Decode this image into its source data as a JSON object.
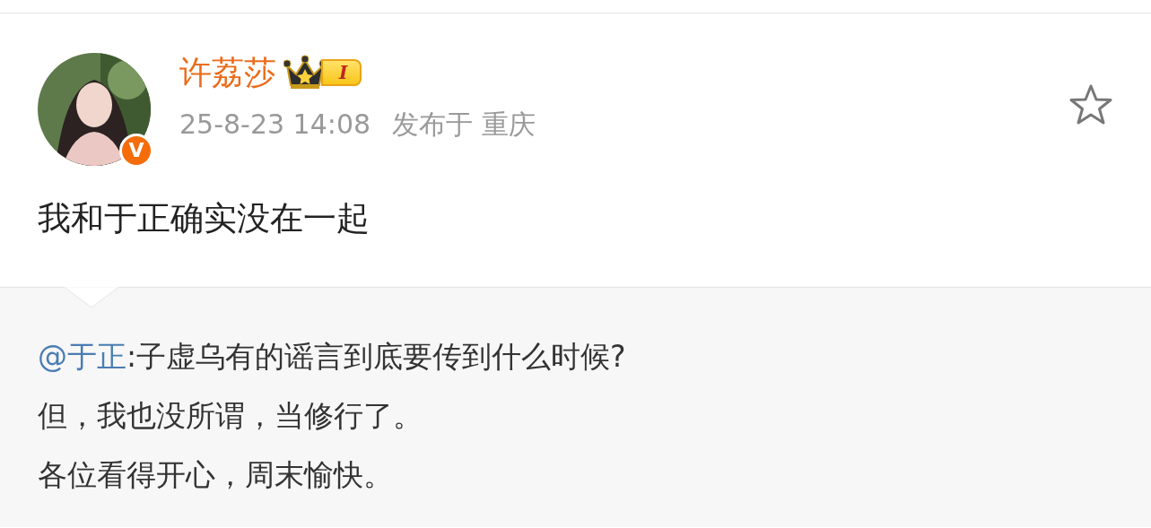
{
  "post": {
    "author": {
      "name": "许荔莎",
      "verified_badge": "V",
      "level_badge": "I"
    },
    "time": "25-8-23 14:08",
    "location": "发布于 重庆",
    "starred": false,
    "text": "我和于正确实没在一起"
  },
  "repost": {
    "mention": "@于正",
    "lines": [
      ":子虚乌有的谣言到底要传到什么时候?",
      "但，我也没所谓，当修行了。",
      "各位看得开心，周末愉快。"
    ]
  }
}
